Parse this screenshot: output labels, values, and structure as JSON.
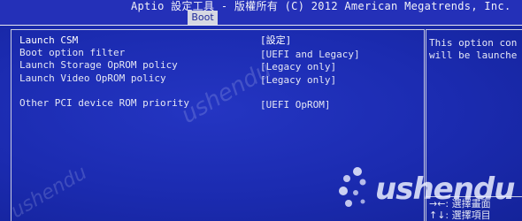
{
  "header": {
    "title": "Aptio 設定工具 - 版權所有 (C) 2012 American Megatrends, Inc.",
    "active_tab": "Boot"
  },
  "options": [
    {
      "label": "Launch CSM",
      "value": "[設定]",
      "selected": true
    },
    {
      "label": "Boot option filter",
      "value": "[UEFI and Legacy]",
      "selected": false
    },
    {
      "label": "Launch Storage OpROM policy",
      "value": "[Legacy only]",
      "selected": false
    },
    {
      "label": "Launch Video OpROM policy",
      "value": "[Legacy only]",
      "selected": false
    },
    {
      "label": "Other PCI device ROM priority",
      "value": "[UEFI OpROM]",
      "selected": false
    }
  ],
  "help": {
    "lines": [
      "This option con",
      "will be launche"
    ]
  },
  "nav_hints": [
    {
      "keys": "→←:",
      "action": "選擇畫面"
    },
    {
      "keys": "↑↓:",
      "action": "選擇項目"
    }
  ],
  "watermark": {
    "text": "ushendu"
  },
  "colors": {
    "background": "#1b2bb0",
    "tab_background": "#d6d8e2",
    "text": "#e6e8f5"
  }
}
